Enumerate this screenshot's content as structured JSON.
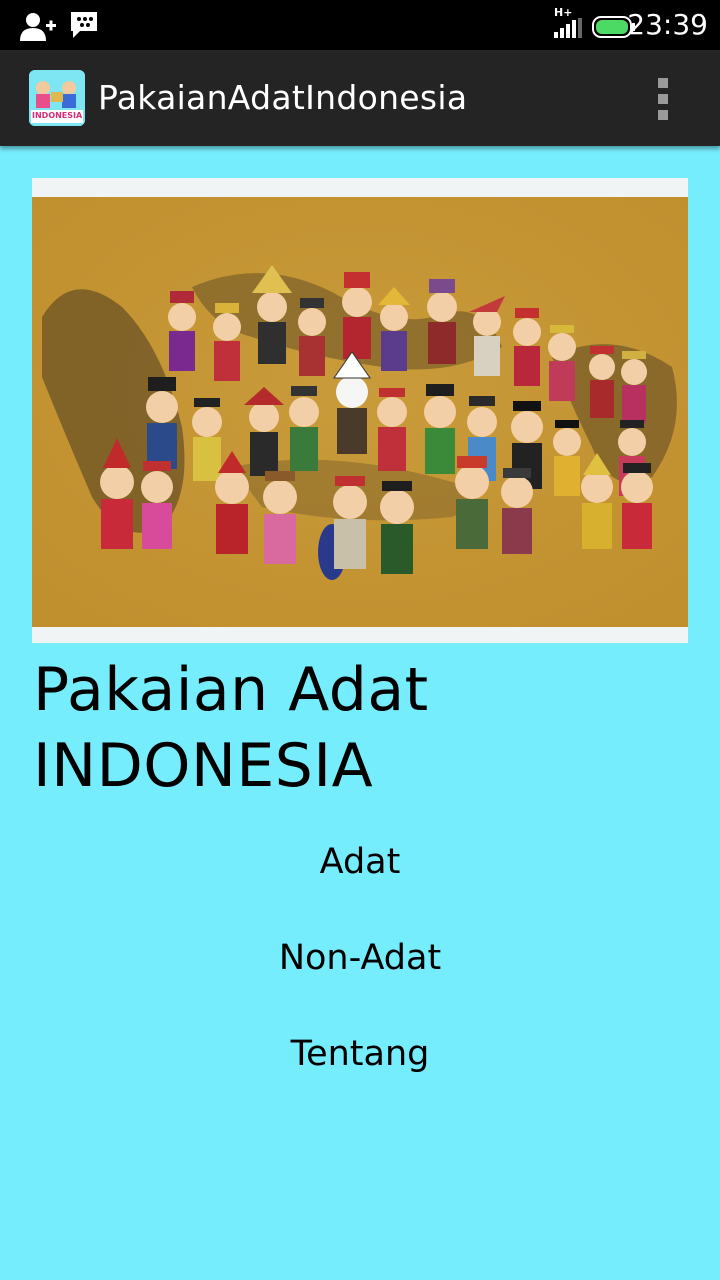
{
  "status_bar": {
    "time": "23:39",
    "network_label": "H+",
    "icons": [
      "add-contact-icon",
      "bbm-chat-icon",
      "signal-icon",
      "battery-icon"
    ]
  },
  "action_bar": {
    "title": "PakaianAdatIndonesia",
    "app_icon_text": "INDONESIA",
    "overflow_icon": "overflow-menu-icon"
  },
  "main": {
    "title_line1": "Pakaian Adat",
    "title_line2": "INDONESIA",
    "menu": [
      {
        "label": "Adat"
      },
      {
        "label": "Non-Adat"
      },
      {
        "label": "Tentang"
      }
    ]
  },
  "colors": {
    "background": "#76edfd",
    "action_bar": "#242424",
    "status_bar": "#000000",
    "battery": "#4cd964"
  }
}
